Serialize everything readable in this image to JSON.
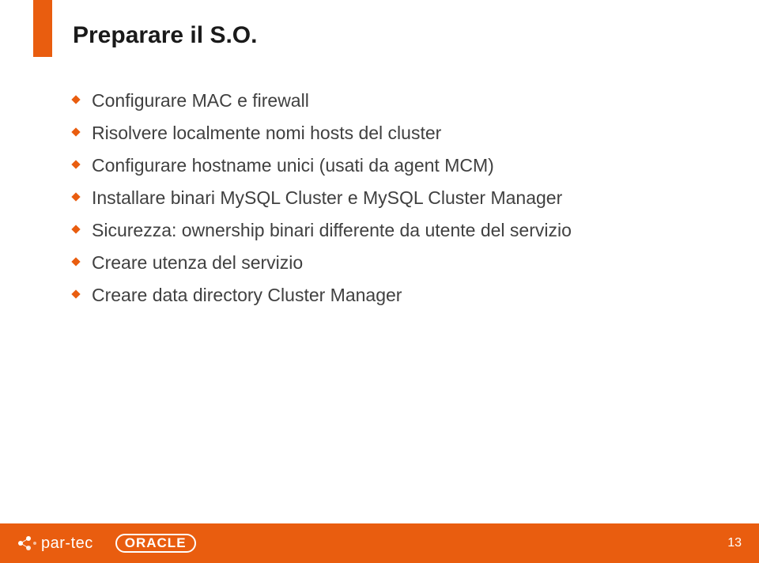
{
  "title": "Preparare il S.O.",
  "bullets": [
    "Configurare MAC e firewall",
    "Risolvere localmente nomi hosts del cluster",
    "Configurare hostname unici (usati da agent MCM)",
    "Installare binari MySQL Cluster e MySQL Cluster Manager",
    "Sicurezza: ownership binari differente da utente del servizio",
    "Creare utenza del servizio",
    "Creare data directory Cluster Manager"
  ],
  "footer": {
    "logo1": "par-tec",
    "logo2": "ORACLE",
    "page": "13"
  }
}
